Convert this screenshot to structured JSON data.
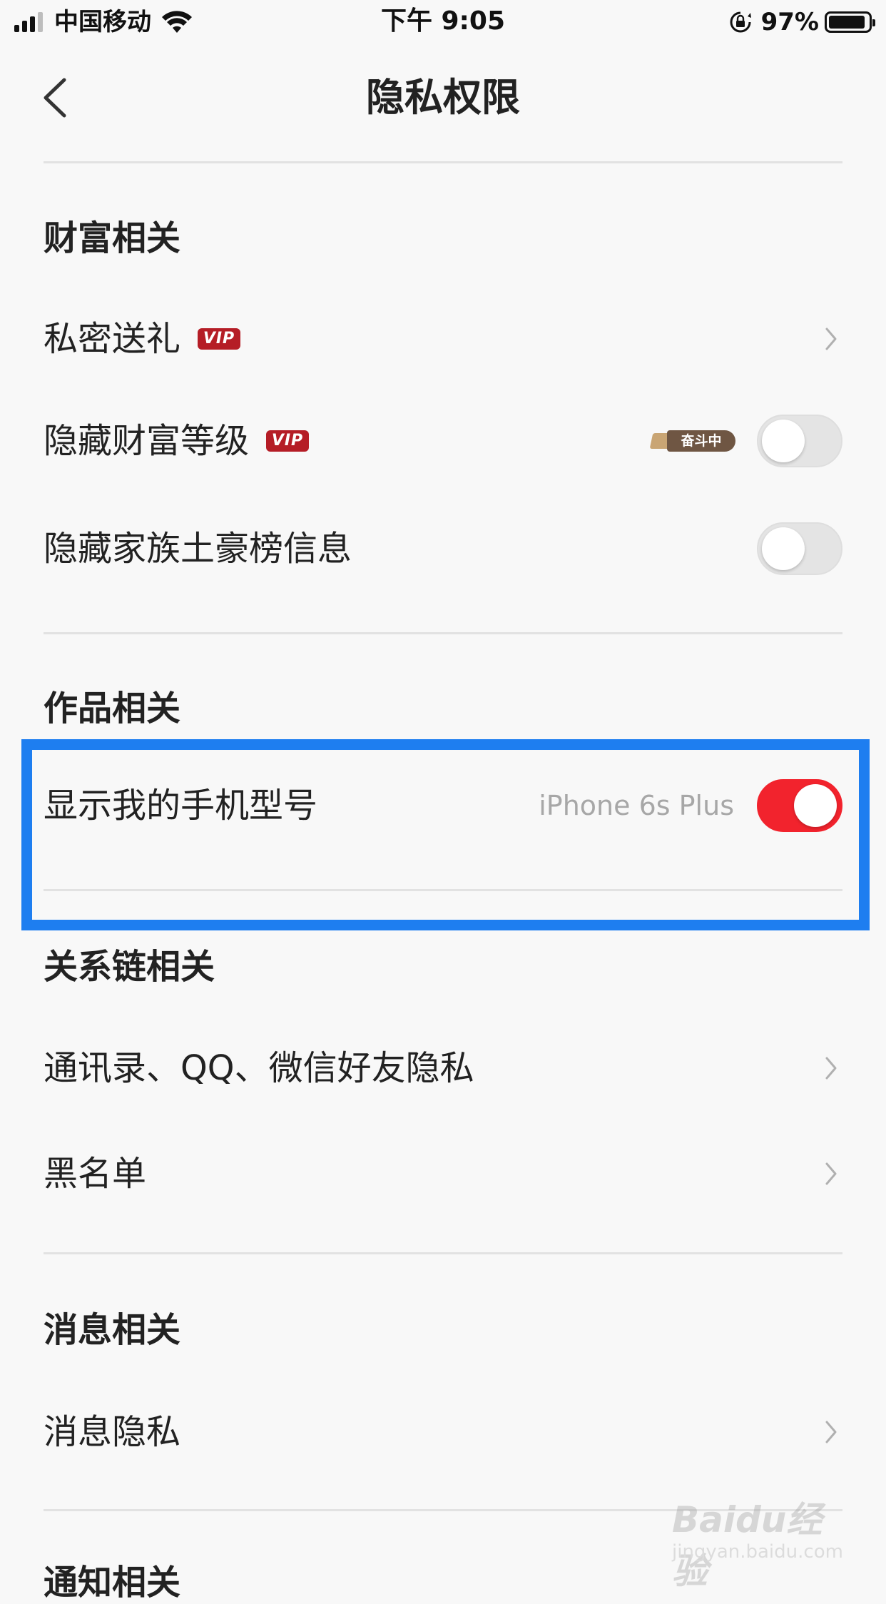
{
  "status_bar": {
    "carrier": "中国移动",
    "time": "下午 9:05",
    "battery_percent": "97%",
    "signal_bars_active": 3,
    "icons": [
      "signal-icon",
      "wifi-icon",
      "rotation-lock-icon",
      "battery-icon"
    ]
  },
  "nav": {
    "title": "隐私权限",
    "back_icon": "chevron-left-icon"
  },
  "sections": {
    "wealth": {
      "title": "财富相关",
      "private_gift": {
        "label": "私密送礼",
        "badge": "VIP"
      },
      "hide_wealth_level": {
        "label": "隐藏财富等级",
        "badge": "VIP",
        "status_badge": "奋斗中",
        "enabled": false
      },
      "hide_family_rich_list": {
        "label": "隐藏家族土豪榜信息",
        "enabled": false
      }
    },
    "works": {
      "title": "作品相关",
      "show_phone_model": {
        "label": "显示我的手机型号",
        "value": "iPhone 6s Plus",
        "enabled": true
      }
    },
    "relations": {
      "title": "关系链相关",
      "contacts_privacy": {
        "label": "通讯录、QQ、微信好友隐私"
      },
      "blacklist": {
        "label": "黑名单"
      }
    },
    "messages": {
      "title": "消息相关",
      "message_privacy": {
        "label": "消息隐私"
      }
    },
    "notifications": {
      "title": "通知相关"
    }
  },
  "watermark": {
    "text": "Baidu经验",
    "sub": "jingyan.baidu.com"
  },
  "colors": {
    "toggle_on": "#f2232d",
    "toggle_off": "#e4e4e4",
    "vip_badge": "#b51d26",
    "highlight_border": "#1e7ef0",
    "background": "#f8f8f8"
  }
}
